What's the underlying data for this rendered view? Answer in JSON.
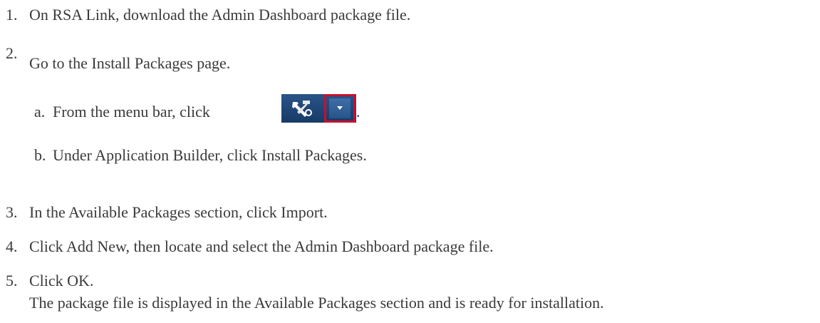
{
  "steps": [
    {
      "num": "1.",
      "text": "On RSA Link, download the Admin Dashboard package file."
    },
    {
      "num": "2.",
      "text": "Go to the Install Packages page."
    },
    {
      "num": "3.",
      "text": "In the Available Packages section, click Import."
    },
    {
      "num": "4.",
      "text": "Click Add New, then locate and select the Admin Dashboard package file."
    },
    {
      "num": "5.",
      "text": "Click OK."
    }
  ],
  "substeps": [
    {
      "num": "a.",
      "text": "From the menu bar, click",
      "suffix": "."
    },
    {
      "num": "b.",
      "text": "Under Application Builder, click Install Packages."
    }
  ],
  "result_text": "The package file is displayed in the Available Packages section and is ready for installation.",
  "icons": {
    "tools": "tools-icon",
    "dropdown": "chevron-down-icon",
    "highlight_color": "#c8102e",
    "toolbar_color": "#1c3f6e"
  }
}
